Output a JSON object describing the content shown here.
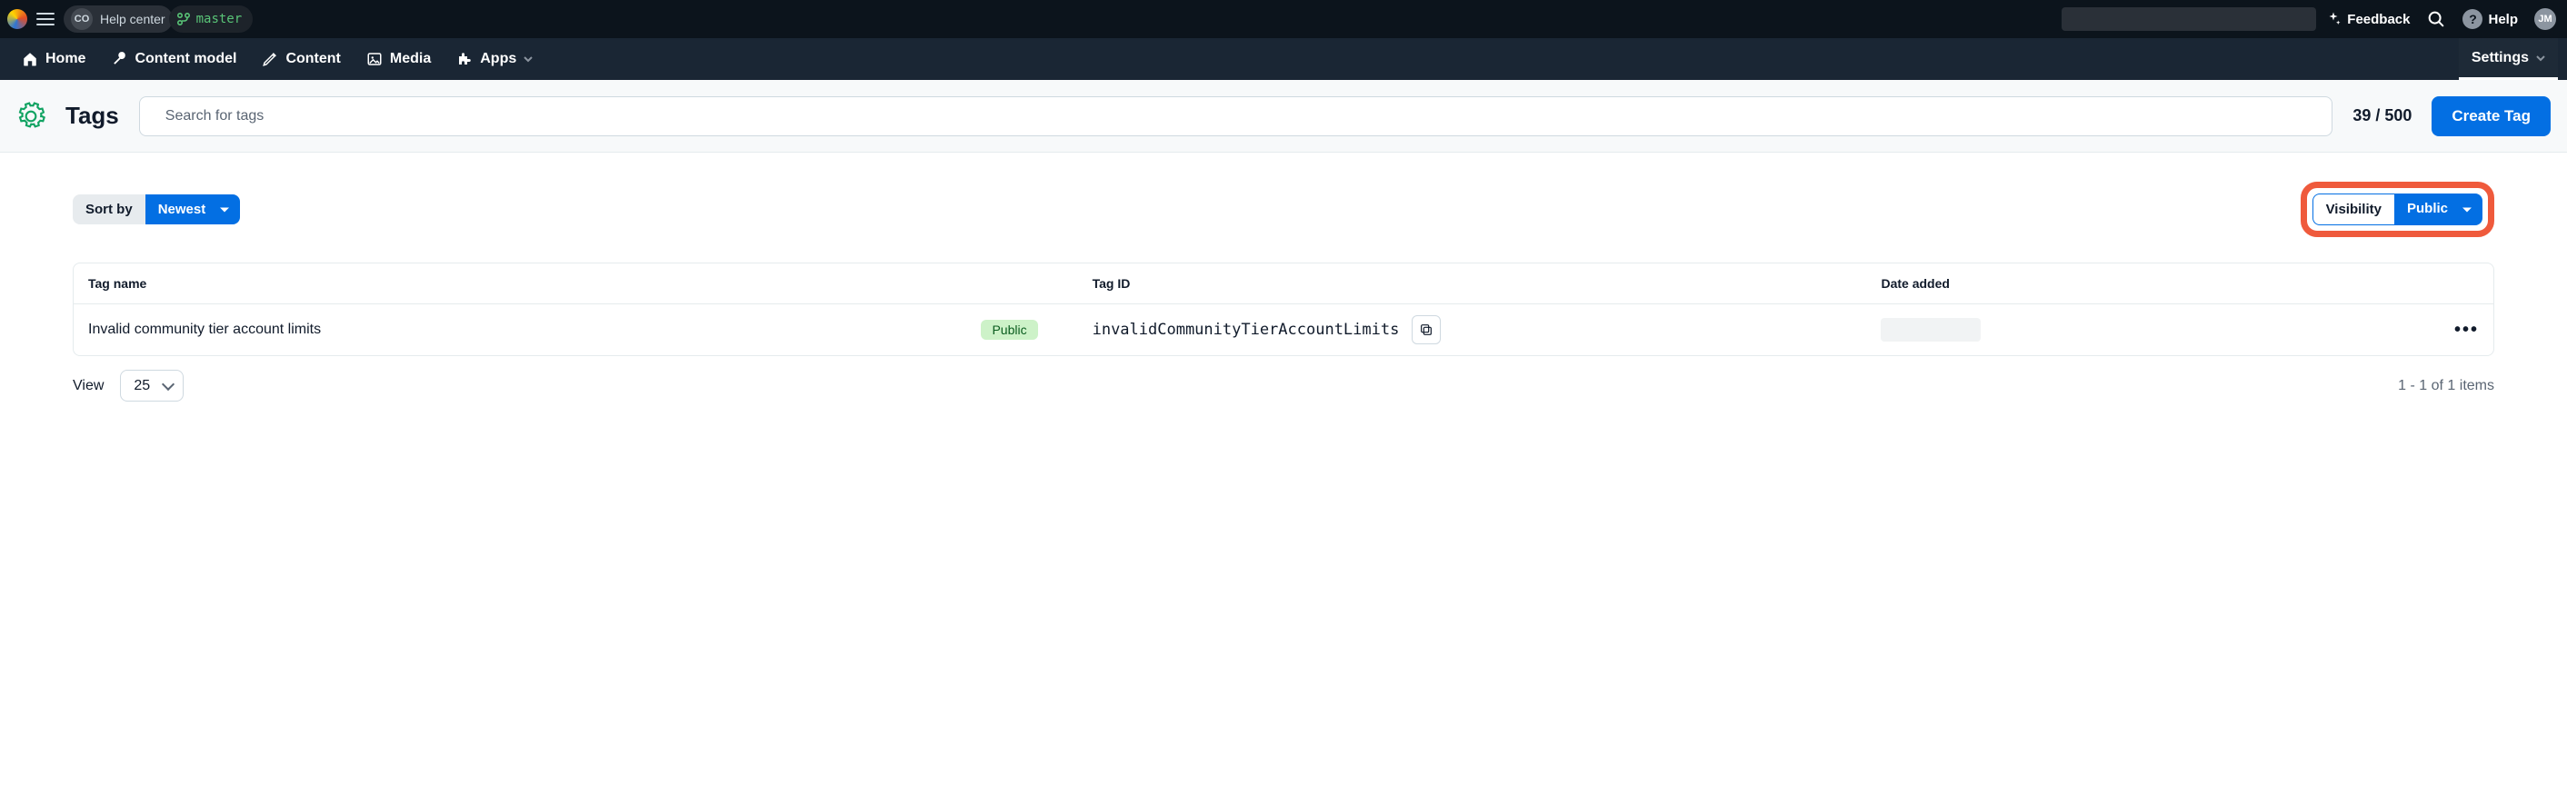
{
  "topbar": {
    "org_badge": "CO",
    "space_name": "Help center",
    "branch": "master",
    "feedback": "Feedback",
    "help": "Help",
    "user_initials": "JM"
  },
  "nav": {
    "home": "Home",
    "content_model": "Content model",
    "content": "Content",
    "media": "Media",
    "apps": "Apps",
    "settings": "Settings"
  },
  "header": {
    "title": "Tags",
    "search_placeholder": "Search for tags",
    "counter": "39 / 500",
    "create_btn": "Create Tag"
  },
  "toolbar": {
    "sort_label": "Sort by",
    "sort_value": "Newest",
    "visibility_label": "Visibility",
    "visibility_value": "Public"
  },
  "columns": {
    "name": "Tag name",
    "id": "Tag ID",
    "date": "Date added"
  },
  "rows": [
    {
      "name": "Invalid community tier account limits",
      "badge": "Public",
      "id": "invalidCommunityTierAccountLimits"
    }
  ],
  "footer": {
    "view_label": "View",
    "page_size": "25",
    "range": "1 - 1 of 1 items"
  }
}
